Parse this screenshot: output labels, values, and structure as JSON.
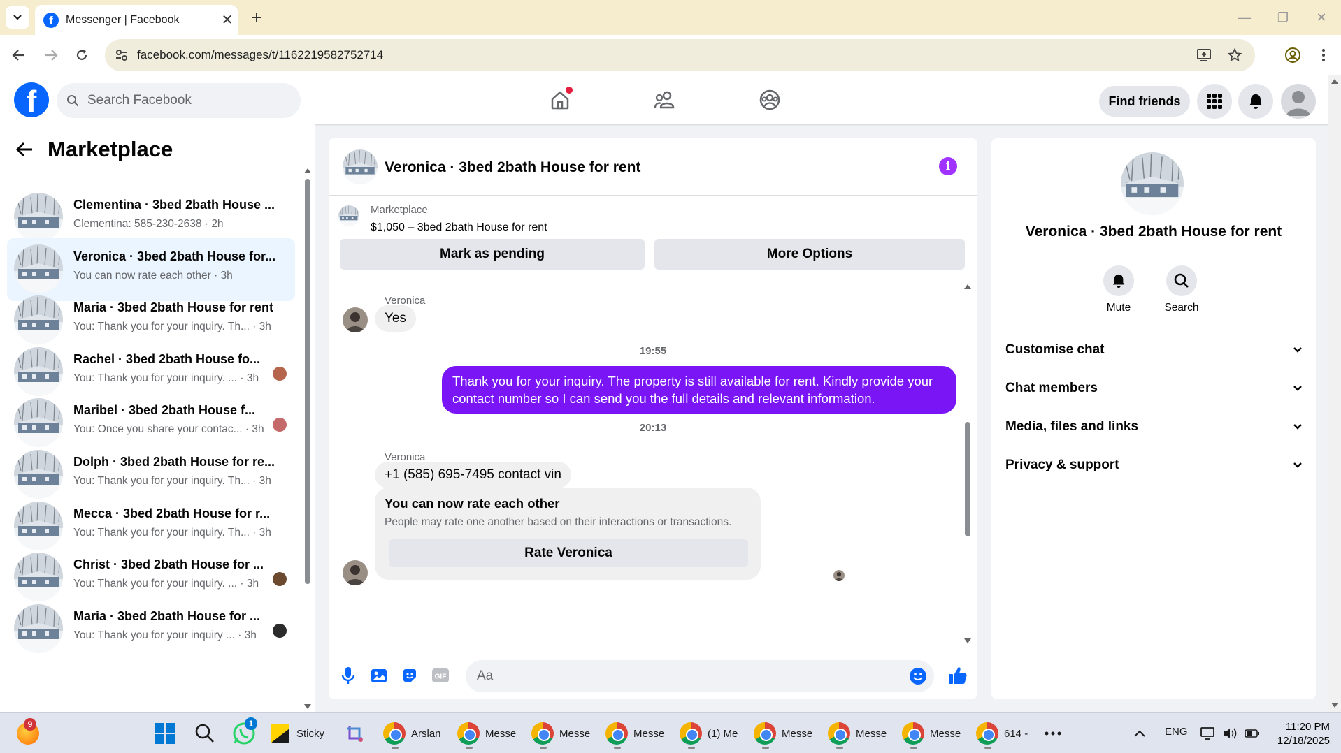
{
  "browser": {
    "tab_title": "Messenger | Facebook",
    "url": "facebook.com/messages/t/1162219582752714"
  },
  "header": {
    "search_placeholder": "Search Facebook",
    "find_friends": "Find friends"
  },
  "sidebar": {
    "title": "Marketplace",
    "conversations": [
      {
        "name": "Clementina · 3bed 2bath House ...",
        "preview": "Clementina: 585-230-2638 · 2h",
        "active": false
      },
      {
        "name": "Veronica · 3bed 2bath House for...",
        "preview": "You can now rate each other · 3h",
        "active": true
      },
      {
        "name": "Maria · 3bed 2bath House for rent",
        "preview": "You: Thank you for your inquiry. Th... · 3h",
        "active": false
      },
      {
        "name": "Rachel · 3bed 2bath House fo...",
        "preview": "You: Thank you for your inquiry. ... · 3h",
        "active": false
      },
      {
        "name": "Maribel · 3bed 2bath House f...",
        "preview": "You: Once you share your contac... · 3h",
        "active": false
      },
      {
        "name": "Dolph · 3bed 2bath House for re...",
        "preview": "You: Thank you for your inquiry. Th... · 3h",
        "active": false
      },
      {
        "name": "Mecca · 3bed 2bath House for r...",
        "preview": "You: Thank you for your inquiry. Th... · 3h",
        "active": false
      },
      {
        "name": "Christ · 3bed 2bath House for ...",
        "preview": "You: Thank you for your inquiry. ... · 3h",
        "active": false
      },
      {
        "name": "Maria · 3bed 2bath House for ...",
        "preview": "You: Thank you for your inquiry ... · 3h",
        "active": false
      }
    ]
  },
  "chat": {
    "title": "Veronica · 3bed 2bath House for rent",
    "listing_category": "Marketplace",
    "listing_price": "$1,050 – 3bed 2bath House for rent",
    "mark_pending": "Mark as pending",
    "more_options": "More Options",
    "messages": {
      "sender1": "Veronica",
      "msg1": "Yes",
      "time1": "19:55",
      "out1": "Thank you for your inquiry. The property is still available for rent. Kindly provide your contact number so I can send you the full details and relevant information.",
      "time2": "20:13",
      "sender2": "Veronica",
      "msg2": "+1 (585) 695-7495 contact vin"
    },
    "rate_card": {
      "heading": "You can now rate each other",
      "subtext": "People may rate one another based on their interactions or transactions.",
      "button": "Rate Veronica"
    },
    "input_placeholder": "Aa"
  },
  "details": {
    "title": "Veronica · 3bed 2bath House for rent",
    "mute": "Mute",
    "search": "Search",
    "sections": [
      "Customise chat",
      "Chat members",
      "Media, files and links",
      "Privacy & support"
    ]
  },
  "taskbar": {
    "badge_browser": "9",
    "badge_whatsapp": "1",
    "sticky": "Sticky",
    "apps": [
      "Arslan",
      "Messe",
      "Messe",
      "Messe",
      "(1) Me",
      "Messe",
      "Messe",
      "Messe",
      "614 -"
    ],
    "lang": "ENG",
    "time": "11:20 PM",
    "date": "12/18/2025"
  },
  "colors": {
    "fb_blue": "#0866ff",
    "outgoing_bubble": "#7a16f5",
    "active_row": "#ebf5ff",
    "info_icon": "#a033ff"
  }
}
